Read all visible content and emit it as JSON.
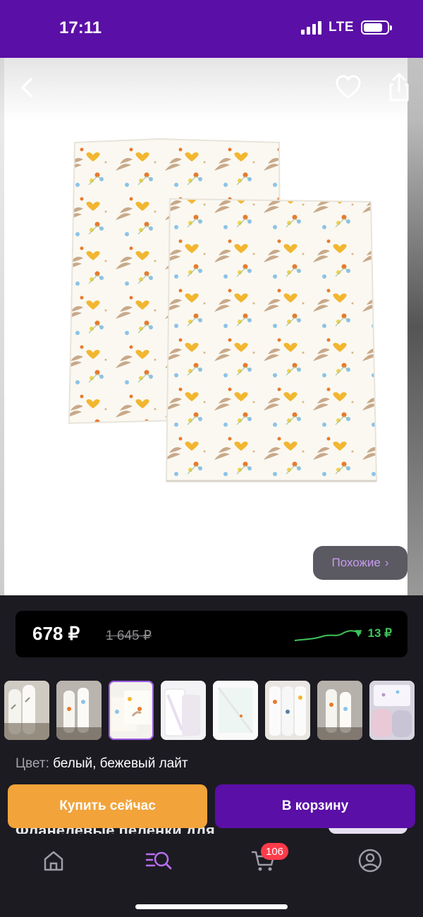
{
  "status_bar": {
    "time": "17:11",
    "network": "LTE",
    "battery_percent": 80
  },
  "gallery": {
    "back_icon": "chevron-left-icon",
    "favorite_icon": "heart-icon",
    "share_icon": "share-icon",
    "similar_button": "Похожие",
    "similar_chevron": "›"
  },
  "price": {
    "current": "678 ₽",
    "old": "1 645 ₽",
    "drop": "▼ 13 ₽",
    "drop_color": "#3ec45a"
  },
  "thumbnails": {
    "count": 8,
    "active_index": 2
  },
  "variant": {
    "label": "Цвет:",
    "value": "белый, бежевый лайт"
  },
  "product_title_partial": "Фланелевые пеленки для",
  "actions": {
    "buy_now": "Купить сейчас",
    "add_to_cart": "В корзину"
  },
  "tabbar": {
    "items": [
      {
        "name": "home",
        "icon": "home-icon"
      },
      {
        "name": "catalog",
        "icon": "catalog-search-icon",
        "active": true
      },
      {
        "name": "cart",
        "icon": "cart-icon",
        "badge": "106"
      },
      {
        "name": "profile",
        "icon": "profile-icon"
      }
    ]
  },
  "colors": {
    "brand": "#5a0fa6",
    "accent_orange": "#f2a33a",
    "badge_red": "#ff3b4a",
    "active_tab": "#b86ef0"
  }
}
